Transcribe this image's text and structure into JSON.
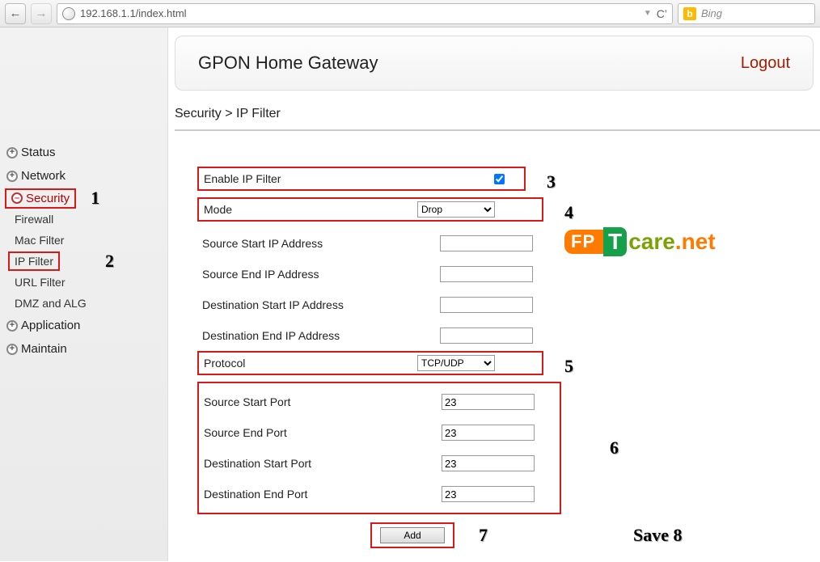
{
  "browser": {
    "url": "192.168.1.1/index.html",
    "search_placeholder": "Bing"
  },
  "header": {
    "title": "GPON Home Gateway",
    "logout": "Logout"
  },
  "breadcrumb": "Security > IP Filter",
  "sidebar": {
    "items": [
      {
        "label": "Status",
        "icon": "plus"
      },
      {
        "label": "Network",
        "icon": "plus"
      },
      {
        "label": "Security",
        "icon": "minus",
        "active": true
      },
      {
        "label": "Application",
        "icon": "plus"
      },
      {
        "label": "Maintain",
        "icon": "plus"
      }
    ],
    "security_sub": [
      {
        "label": "Firewall"
      },
      {
        "label": "Mac Filter"
      },
      {
        "label": "IP Filter",
        "active": true
      },
      {
        "label": "URL Filter"
      },
      {
        "label": "DMZ and ALG"
      }
    ]
  },
  "form": {
    "enable_label": "Enable IP Filter",
    "enable_checked": true,
    "mode_label": "Mode",
    "mode_value": "Drop",
    "src_start_ip_label": "Source Start IP Address",
    "src_start_ip": "",
    "src_end_ip_label": "Source End IP Address",
    "src_end_ip": "",
    "dst_start_ip_label": "Destination Start IP Address",
    "dst_start_ip": "",
    "dst_end_ip_label": "Destination End IP Address",
    "dst_end_ip": "",
    "protocol_label": "Protocol",
    "protocol_value": "TCP/UDP",
    "src_start_port_label": "Source Start Port",
    "src_start_port": "23",
    "src_end_port_label": "Source End Port",
    "src_end_port": "23",
    "dst_start_port_label": "Destination Start Port",
    "dst_start_port": "23",
    "dst_end_port_label": "Destination End Port",
    "dst_end_port": "23",
    "add_button": "Add"
  },
  "annotations": {
    "a1": "1",
    "a2": "2",
    "a3": "3",
    "a4": "4",
    "a5": "5",
    "a6": "6",
    "a7": "7",
    "a8": "Save 8"
  },
  "watermark": {
    "fp": "FP",
    "t": "T",
    "care": "care",
    "net": ".net"
  }
}
